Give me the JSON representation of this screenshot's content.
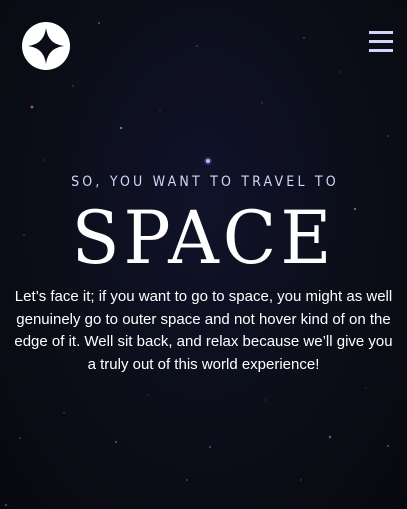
{
  "header": {
    "logo_icon": "four-point-star-icon",
    "menu_icon": "hamburger-icon"
  },
  "hero": {
    "eyebrow": "SO, YOU WANT TO TRAVEL TO",
    "headline": "SPACE",
    "intro": "Let’s face it; if you want to go to space, you might as well genuinely go to outer space and not hover kind of on the edge of it. Well sit back, and relax because we’ll give you a truly out of this world experience!"
  },
  "colors": {
    "background": "#0b0d17",
    "text_light": "#d0d6f9",
    "white": "#ffffff"
  }
}
